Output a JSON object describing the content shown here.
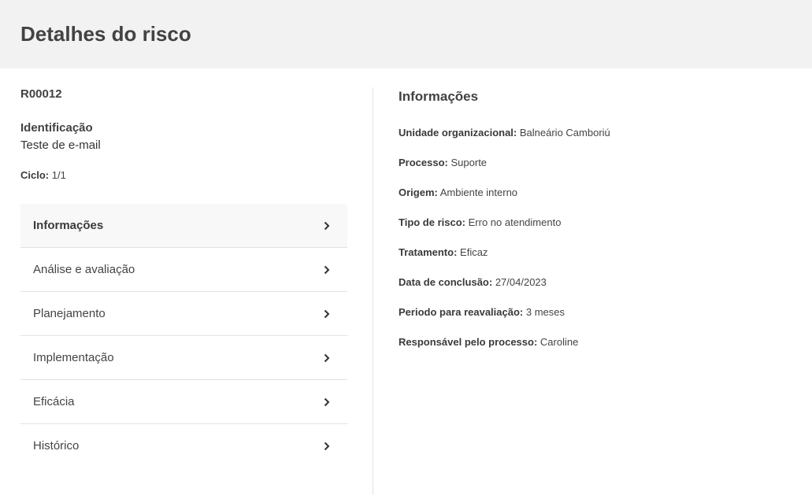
{
  "header": {
    "title": "Detalhes do risco"
  },
  "risk": {
    "code": "R00012",
    "identification_label": "Identificação",
    "identification_value": "Teste de e-mail",
    "cycle_label": "Ciclo:",
    "cycle_value": "1/1"
  },
  "menu": {
    "items": [
      {
        "label": "Informações"
      },
      {
        "label": "Análise e avaliação"
      },
      {
        "label": "Planejamento"
      },
      {
        "label": "Implementação"
      },
      {
        "label": "Eficácia"
      },
      {
        "label": "Histórico"
      }
    ]
  },
  "details": {
    "title": "Informações",
    "fields": [
      {
        "label": "Unidade organizacional:",
        "value": "Balneário Camboriú"
      },
      {
        "label": "Processo:",
        "value": "Suporte"
      },
      {
        "label": "Origem:",
        "value": "Ambiente interno"
      },
      {
        "label": "Tipo de risco:",
        "value": "Erro no atendimento"
      },
      {
        "label": "Tratamento:",
        "value": "Eficaz"
      },
      {
        "label": "Data de conclusão:",
        "value": "27/04/2023"
      },
      {
        "label": "Periodo para reavaliação:",
        "value": "3 meses"
      },
      {
        "label": "Responsável pelo processo:",
        "value": "Caroline"
      }
    ]
  }
}
